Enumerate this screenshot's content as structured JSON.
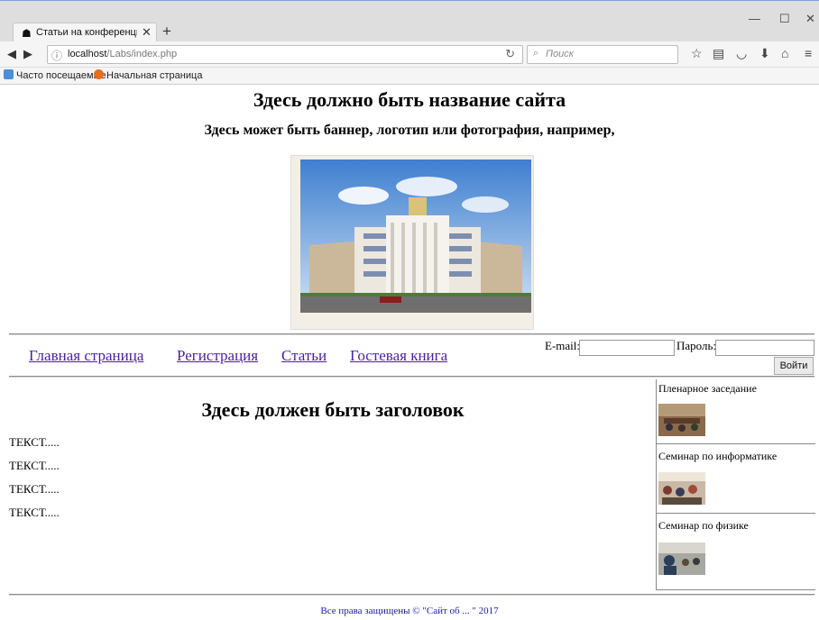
{
  "browser": {
    "tab_title": "Статьи на конференцию М",
    "url_host": "localhost",
    "url_path": "/Labs/index.php",
    "search_placeholder": "Поиск",
    "bookmarks": [
      "Часто посещаемые",
      "Начальная страница"
    ]
  },
  "page": {
    "site_title": "Здесь должно быть название сайта",
    "banner_text": "Здесь может быть баннер, логотип или фотография, например,",
    "menu": [
      "Главная страница",
      "Регистрация",
      "Статьи",
      "Гостевая книга"
    ],
    "login": {
      "email_label": "E-mail:",
      "password_label": "Пароль:",
      "button": "Войти"
    },
    "content_title": "Здесь должен быть заголовок",
    "text_lines": [
      "ТЕКСТ.....",
      "ТЕКСТ.....",
      "ТЕКСТ.....",
      "ТЕКСТ....."
    ],
    "sidebar": [
      "Пленарное заседание",
      "Семинар по информатике",
      "Семинар по физике"
    ],
    "footer": "Все права защищены © \"Сайт об ... \" 2017"
  },
  "colors": {
    "link": "#4b1fa0",
    "footer": "#1a1aa6"
  }
}
